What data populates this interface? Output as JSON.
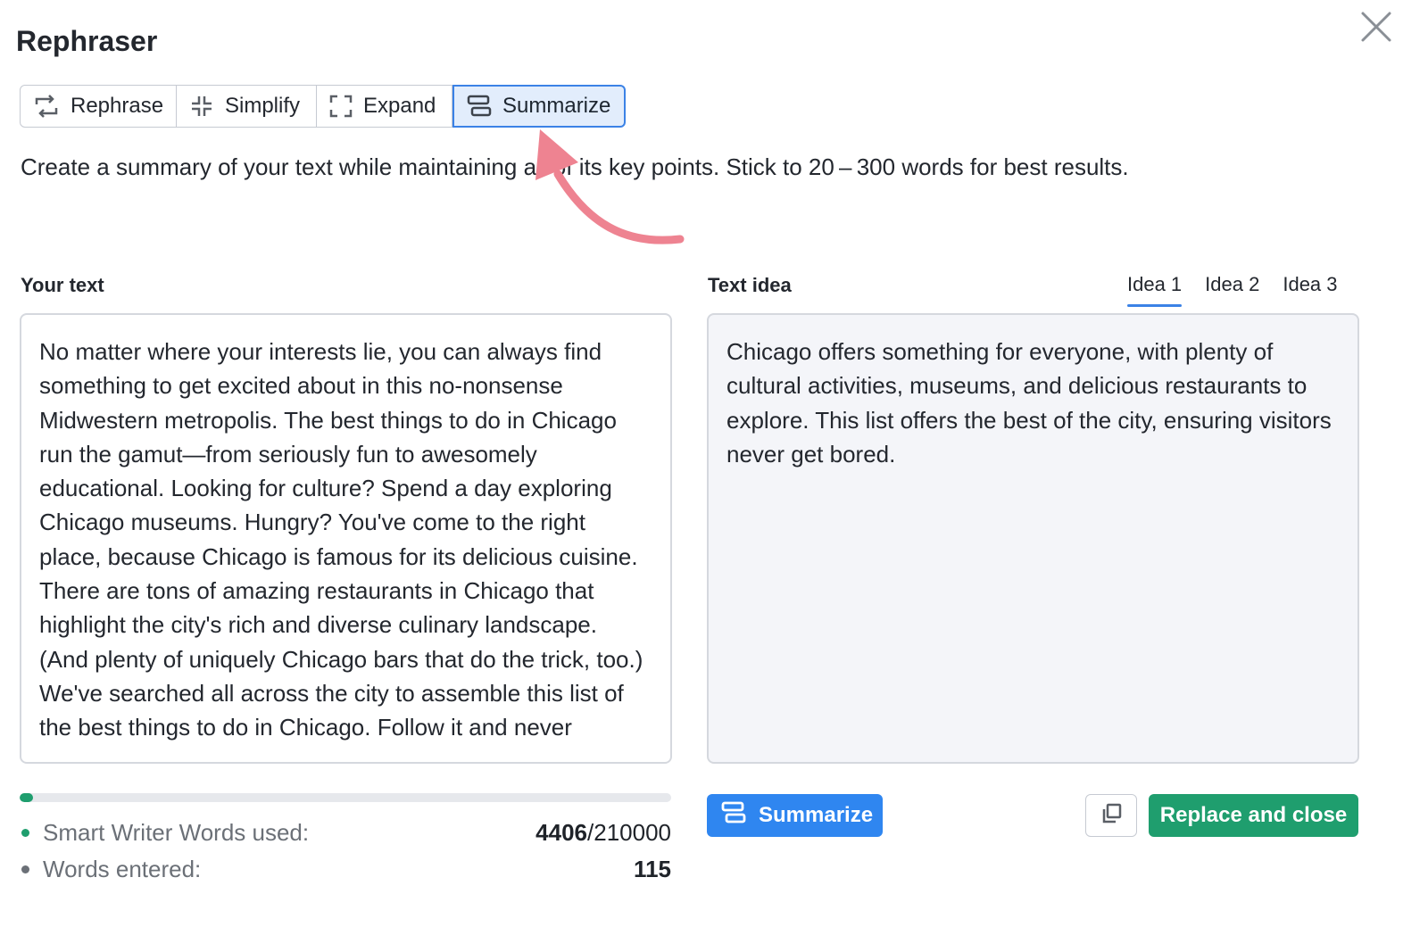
{
  "dialog": {
    "title": "Rephraser",
    "close_icon": "close-icon"
  },
  "modes": [
    {
      "label": "Rephrase",
      "icon": "rephrase-icon"
    },
    {
      "label": "Simplify",
      "icon": "simplify-icon"
    },
    {
      "label": "Expand",
      "icon": "expand-icon"
    },
    {
      "label": "Summarize",
      "icon": "summarize-icon",
      "active": true
    }
  ],
  "description": "Create a summary of your text while maintaining all of its key points. Stick to 20 – 300 words for best results.",
  "input": {
    "label": "Your text",
    "text": "No matter where your interests lie, you can always find something to get excited about in this no-nonsense Midwestern metropolis. The best things to do in Chicago run the gamut—from seriously fun to awesomely educational. Looking for culture? Spend a day exploring Chicago museums. Hungry? You've come to the right place, because Chicago is famous for its delicious cuisine. There are tons of amazing restaurants in Chicago that highlight the city's rich and diverse culinary landscape. (And plenty of uniquely Chicago bars that do the trick, too.) We've searched all across the city to assemble this list of the best things to do in Chicago. Follow it and never"
  },
  "output": {
    "label": "Text idea",
    "tabs": [
      "Idea 1",
      "Idea 2",
      "Idea 3"
    ],
    "active_tab": "Idea 1",
    "text": "Chicago offers something for everyone, with plenty of cultural activities, museums, and delicious restaurants to explore. This list offers the best of the city, ensuring visitors never get bored."
  },
  "usage": {
    "progress_fraction": 0.021,
    "smart_words_label": "Smart Writer Words used:",
    "smart_words_used": "4406",
    "smart_words_total": "/210000",
    "words_entered_label": "Words entered:",
    "words_entered": "115"
  },
  "actions": {
    "summarize_label": "Summarize",
    "copy_icon": "copy-icon",
    "replace_label": "Replace and close"
  },
  "colors": {
    "accent_blue": "#2f86f0",
    "active_mode_bg": "#e2edfc",
    "success_green": "#1f9e6e",
    "annotation_arrow": "#ee8391"
  }
}
